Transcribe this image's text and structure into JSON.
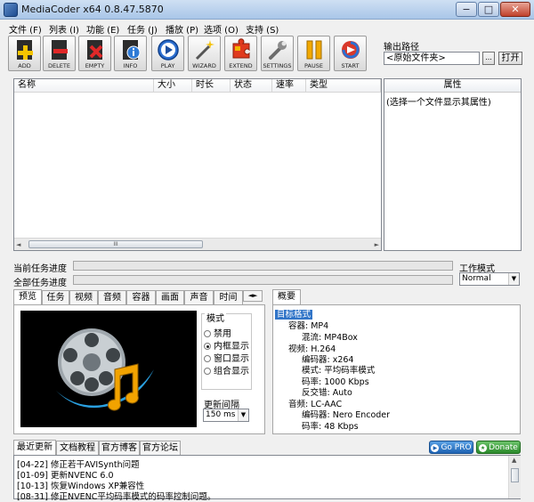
{
  "window": {
    "title": "MediaCoder x64 0.8.47.5870",
    "minimize": "−",
    "maximize": "□",
    "close": "✕"
  },
  "menu": [
    "文件 (F)",
    "列表 (I)",
    "功能 (E)",
    "任务 (J)",
    "播放 (P)",
    "选项 (O)",
    "支持 (S)"
  ],
  "toolbar": {
    "add": "ADD",
    "delete": "DELETE",
    "empty": "EMPTY",
    "info": "INFO",
    "play": "PLAY",
    "wizard": "WIZARD",
    "extend": "EXTEND",
    "settings": "SETTINGS",
    "pause": "PAUSE",
    "start": "START"
  },
  "output": {
    "label": "输出路径",
    "value": "<原始文件夹>",
    "browse": "...",
    "open": "打开"
  },
  "file_list": {
    "columns": [
      "名称",
      "大小",
      "时长",
      "状态",
      "速率",
      "类型"
    ],
    "scroll_grip": "III"
  },
  "properties": {
    "header": "属性",
    "hint": "(选择一个文件显示其属性)"
  },
  "progress": {
    "current_label": "当前任务进度",
    "total_label": "全部任务进度",
    "current_value": 0,
    "total_value": 0
  },
  "work_mode": {
    "label": "工作模式",
    "value": "Normal"
  },
  "left_tabs": [
    "预览",
    "任务",
    "视频",
    "音频",
    "容器",
    "画面",
    "声音",
    "时间"
  ],
  "left_tab_nav": "◄►",
  "mode_group": {
    "title": "模式",
    "options": [
      {
        "label": "禁用",
        "selected": false
      },
      {
        "label": "内框显示",
        "selected": true
      },
      {
        "label": "窗口显示",
        "selected": false
      },
      {
        "label": "组合显示",
        "selected": false
      }
    ],
    "interval_label": "更新间隔",
    "interval_value": "150 ms"
  },
  "summary": {
    "tab": "概要",
    "root": "目标格式",
    "lines": [
      "容器: MP4",
      "混流: MP4Box",
      "视频: H.264",
      "编码器: x264",
      "模式: 平均码率模式",
      "码率: 1000 Kbps",
      "反交错: Auto",
      "音频: LC-AAC",
      "编码器: Nero Encoder",
      "码率: 48 Kbps"
    ]
  },
  "bottom_tabs": [
    "最近更新",
    "文档教程",
    "官方博客",
    "官方论坛"
  ],
  "badges": {
    "gopro": "Go PRO",
    "donate": "Donate"
  },
  "log": [
    "[04-22] 修正若干AVISynth问题",
    "[01-09] 更新NVENC 6.0",
    "[10-13] 恢复Windows XP兼容性",
    "[08-31] 修正NVENC平均码率模式的码率控制问题。"
  ],
  "colors": {
    "accent": "#3175c8",
    "titlebar": "#a9c6e8"
  }
}
